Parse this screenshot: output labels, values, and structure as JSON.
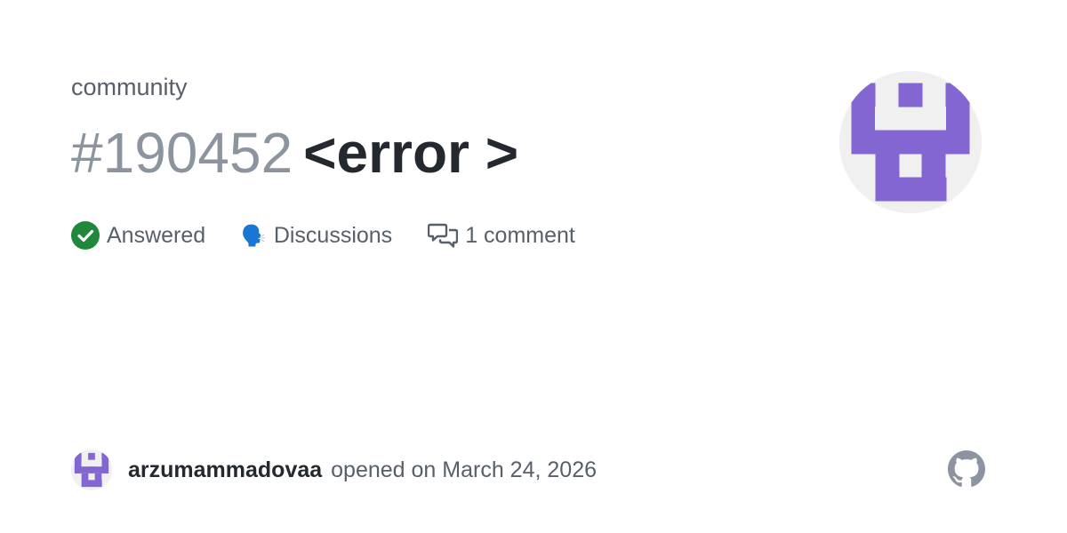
{
  "repo": {
    "name": "community"
  },
  "issue": {
    "number": "#190452",
    "title": "<error >"
  },
  "meta": {
    "status_label": "Answered",
    "category_emoji": "🗣️",
    "category_label": "Discussions",
    "comments_label": "1 comment"
  },
  "footer": {
    "author": "arzumammadovaa",
    "opened_text": "opened on March 24, 2026"
  },
  "icons": {
    "status": "check-circle-icon",
    "comments": "comment-discussion-icon",
    "brand": "github-icon"
  },
  "colors": {
    "status_green": "#1f883d",
    "avatar_purple": "#8466d2",
    "muted_text": "#57606a",
    "number_gray": "#8c959f",
    "title_text": "#24292f"
  }
}
